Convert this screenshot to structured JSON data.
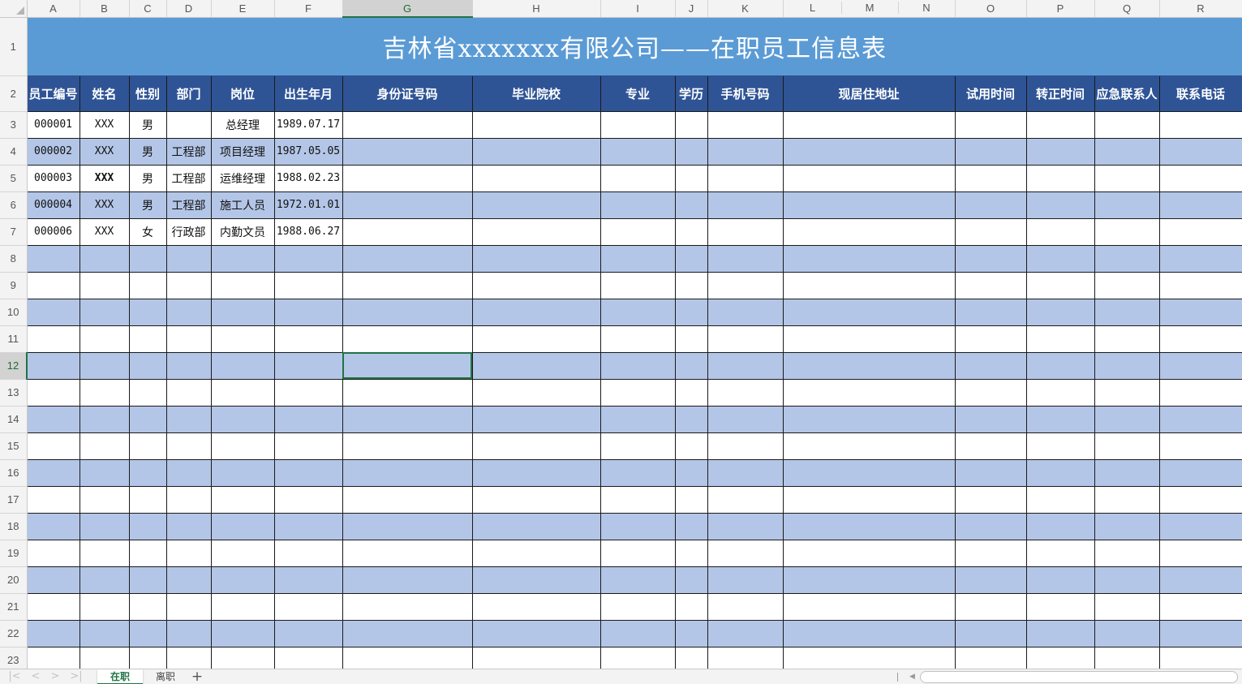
{
  "columns": [
    "A",
    "B",
    "C",
    "D",
    "E",
    "F",
    "G",
    "H",
    "I",
    "J",
    "K",
    "L",
    "M",
    "N",
    "O",
    "P",
    "Q",
    "R"
  ],
  "selected_column": "G",
  "selected_row": 12,
  "title": "吉林省xxxxxxx有限公司——在职员工信息表",
  "headers": [
    "员工编号",
    "姓名",
    "性别",
    "部门",
    "岗位",
    "出生年月",
    "身份证号码",
    "毕业院校",
    "专业",
    "学历",
    "手机号码",
    "现居住地址",
    "试用时间",
    "转正时间",
    "应急联系人",
    "联系电话"
  ],
  "rows": [
    {
      "row": 3,
      "cells": [
        "000001",
        "XXX",
        "男",
        "",
        "总经理",
        "1989.07.17"
      ]
    },
    {
      "row": 4,
      "cells": [
        "000002",
        "XXX",
        "男",
        "工程部",
        "项目经理",
        "1987.05.05"
      ]
    },
    {
      "row": 5,
      "cells": [
        "000003",
        "XXX",
        "男",
        "工程部",
        "运维经理",
        "1988.02.23"
      ]
    },
    {
      "row": 6,
      "cells": [
        "000004",
        "XXX",
        "男",
        "工程部",
        "施工人员",
        "1972.01.01"
      ]
    },
    {
      "row": 7,
      "cells": [
        "000006",
        "XXX",
        "女",
        "行政部",
        "内勤文员",
        "1988.06.27"
      ]
    }
  ],
  "empty_rows": [
    8,
    9,
    10,
    11,
    12,
    13,
    14,
    15,
    16,
    17,
    18,
    19,
    20,
    21,
    22,
    23
  ],
  "sheet_tabs": [
    {
      "label": "在职",
      "active": true
    },
    {
      "label": "离职",
      "active": false
    }
  ],
  "add_sheet_icon": "plus-icon",
  "colors": {
    "title_bg": "#5b9bd5",
    "header_bg": "#2f5496",
    "band": "#b4c6e7",
    "selection": "#217346"
  }
}
